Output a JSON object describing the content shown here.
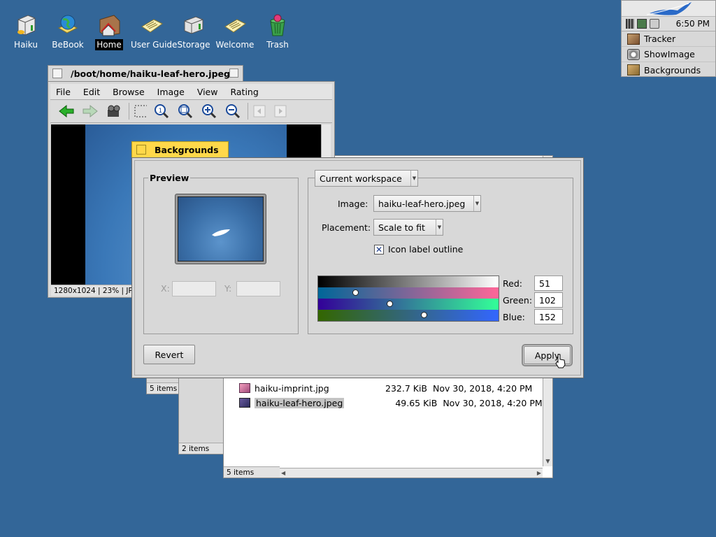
{
  "desktop": {
    "icons": [
      {
        "label": "Haiku"
      },
      {
        "label": "BeBook"
      },
      {
        "label": "Home"
      },
      {
        "label": "User Guide"
      },
      {
        "label": "Storage"
      },
      {
        "label": "Welcome"
      },
      {
        "label": "Trash"
      }
    ]
  },
  "deskbar": {
    "clock": "6:50 PM",
    "apps": [
      {
        "label": "Tracker",
        "icon": "tracker-icon"
      },
      {
        "label": "ShowImage",
        "icon": "showimage-icon"
      },
      {
        "label": "Backgrounds",
        "icon": "backgrounds-icon"
      }
    ]
  },
  "showimage": {
    "title": "/boot/home/haiku-leaf-hero.jpeg",
    "menus": [
      "File",
      "Edit",
      "Browse",
      "Image",
      "View",
      "Rating"
    ],
    "status": "1280x1024  |  23%  |  JPEG"
  },
  "tracker_back": {
    "status_a": "5 items",
    "status_b": "2 items",
    "status_c": "5 items",
    "files": [
      {
        "name": "haiku-imprint.jpg",
        "size": "232.7 KiB",
        "modified": "Nov 30, 2018, 4:20 PM"
      },
      {
        "name": "haiku-leaf-hero.jpeg",
        "size": "49.65 KiB",
        "modified": "Nov 30, 2018, 4:20 PM"
      }
    ]
  },
  "backgrounds": {
    "title": "Backgrounds",
    "preview_label": "Preview",
    "x_label": "X:",
    "y_label": "Y:",
    "workspace_select": "Current workspace",
    "image_label": "Image:",
    "image_value": "haiku-leaf-hero.jpeg",
    "placement_label": "Placement:",
    "placement_value": "Scale to fit",
    "icon_outline_label": "Icon label outline",
    "icon_outline_checked": true,
    "red_label": "Red:",
    "green_label": "Green:",
    "blue_label": "Blue:",
    "red": "51",
    "green": "102",
    "blue": "152",
    "revert_label": "Revert",
    "apply_label": "Apply"
  },
  "colors": {
    "desktop": "#336698",
    "tab_active": "#ffd84a"
  }
}
